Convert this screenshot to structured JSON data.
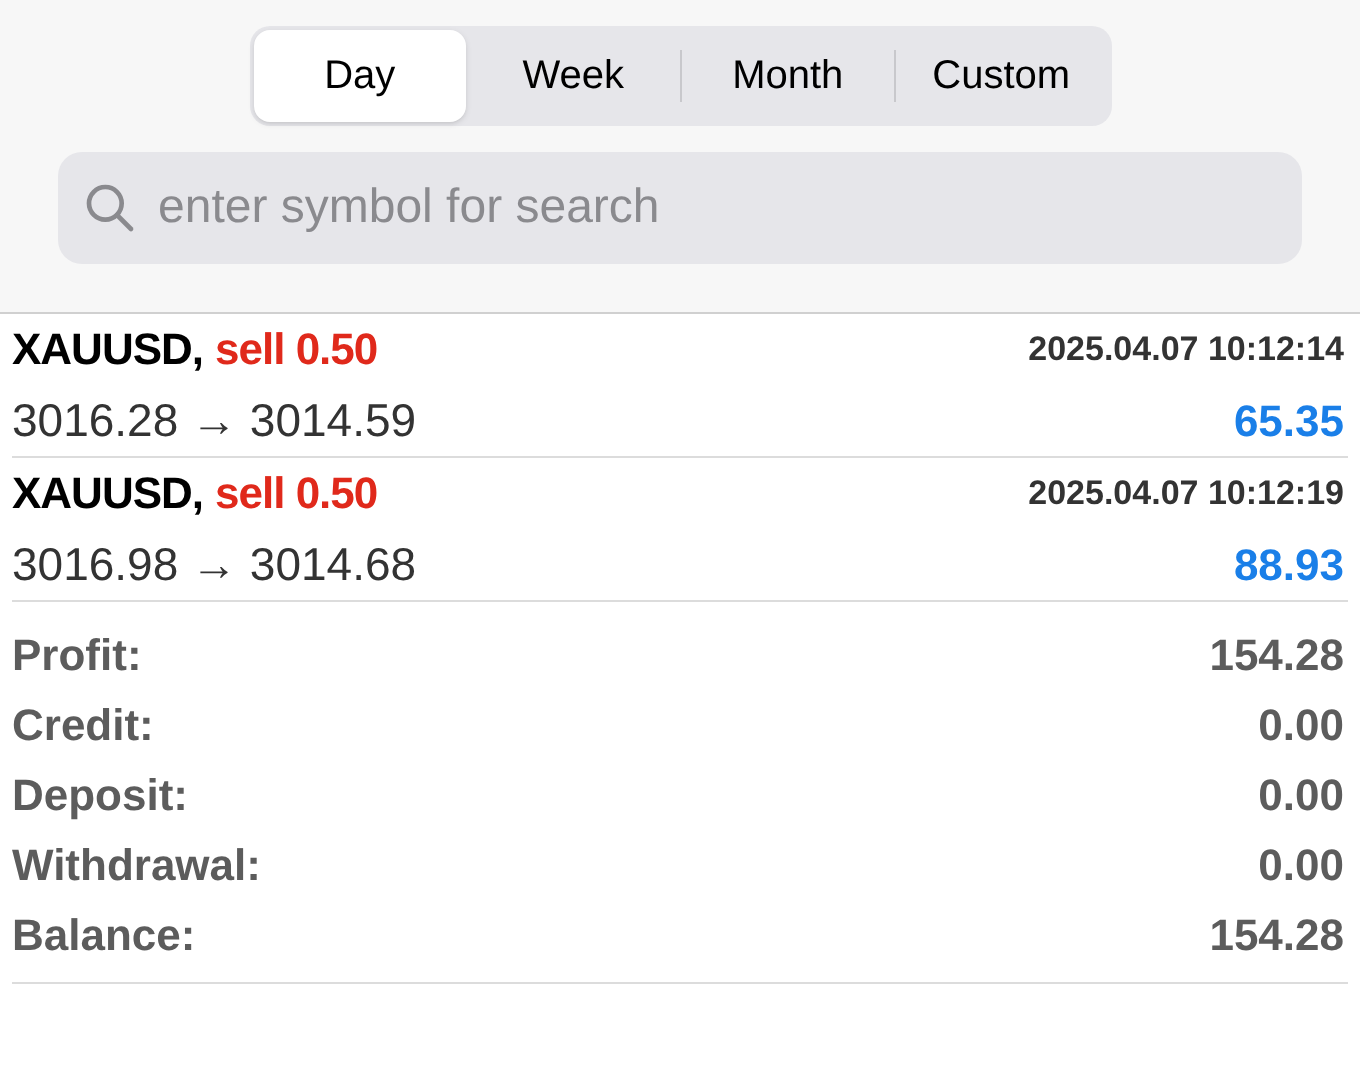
{
  "tabs": [
    {
      "label": "Day",
      "selected": true
    },
    {
      "label": "Week",
      "selected": false
    },
    {
      "label": "Month",
      "selected": false
    },
    {
      "label": "Custom",
      "selected": false
    }
  ],
  "search": {
    "placeholder": "enter symbol for search"
  },
  "deals": [
    {
      "symbol": "XAUUSD,",
      "side": "sell 0.50",
      "time": "2025.04.07 10:12:14",
      "prices": "3016.28 → 3014.59",
      "profit": "65.35"
    },
    {
      "symbol": "XAUUSD,",
      "side": "sell 0.50",
      "time": "2025.04.07 10:12:19",
      "prices": "3016.98 → 3014.68",
      "profit": "88.93"
    }
  ],
  "summary": [
    {
      "label": "Profit:",
      "value": "154.28"
    },
    {
      "label": "Credit:",
      "value": "0.00"
    },
    {
      "label": "Deposit:",
      "value": "0.00"
    },
    {
      "label": "Withdrawal:",
      "value": "0.00"
    },
    {
      "label": "Balance:",
      "value": "154.28"
    }
  ]
}
